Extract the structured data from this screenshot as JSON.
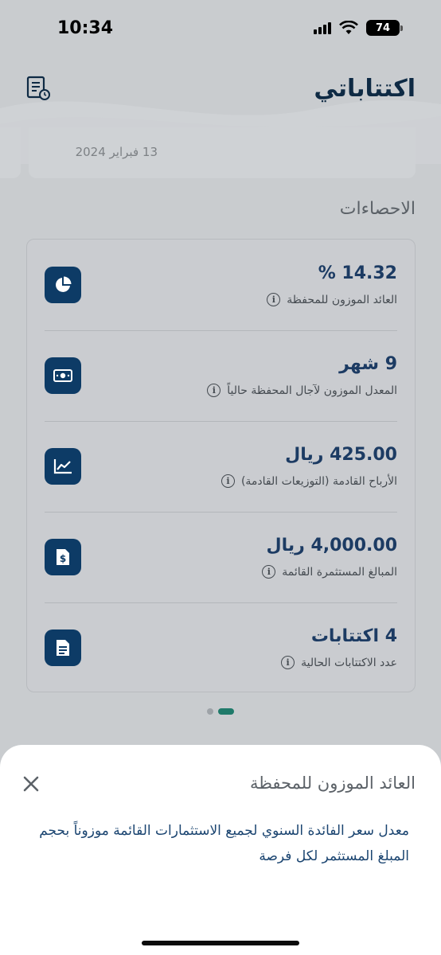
{
  "status": {
    "time": "10:34",
    "battery": "74"
  },
  "header": {
    "title": "اكتتاباتي",
    "history_icon": "document-history-icon"
  },
  "previous_card": {
    "date": "13 فبراير 2024"
  },
  "stats": {
    "section_title": "الاحصاءات",
    "items": [
      {
        "value": "14.32 %",
        "label": "العائد الموزون للمحفظة",
        "icon": "pie-chart-icon"
      },
      {
        "value": "9 شهر",
        "label": "المعدل الموزون لآجال المحفظة حالياً",
        "icon": "money-bill-icon"
      },
      {
        "value": "425.00 ريال",
        "label": "الأرباح القادمة (التوزيعات القادمة)",
        "icon": "line-chart-icon"
      },
      {
        "value": "4,000.00 ريال",
        "label": "المبالغ المستثمرة القائمة",
        "icon": "dollar-document-icon"
      },
      {
        "value": "4 اكتتابات",
        "label": "عدد الاكتتابات الحالية",
        "icon": "document-icon"
      }
    ]
  },
  "pager": {
    "count": 2,
    "active": 1
  },
  "sheet": {
    "title": "العائد الموزون للمحفظة",
    "body": "معدل سعر الفائدة السنوي لجميع الاستثمارات القائمة موزوناً بحجم المبلغ المستثمر لكل فرصة"
  },
  "colors": {
    "primary": "#0d3b66",
    "accent": "#1f7a6a",
    "link_text": "#1a4470"
  }
}
